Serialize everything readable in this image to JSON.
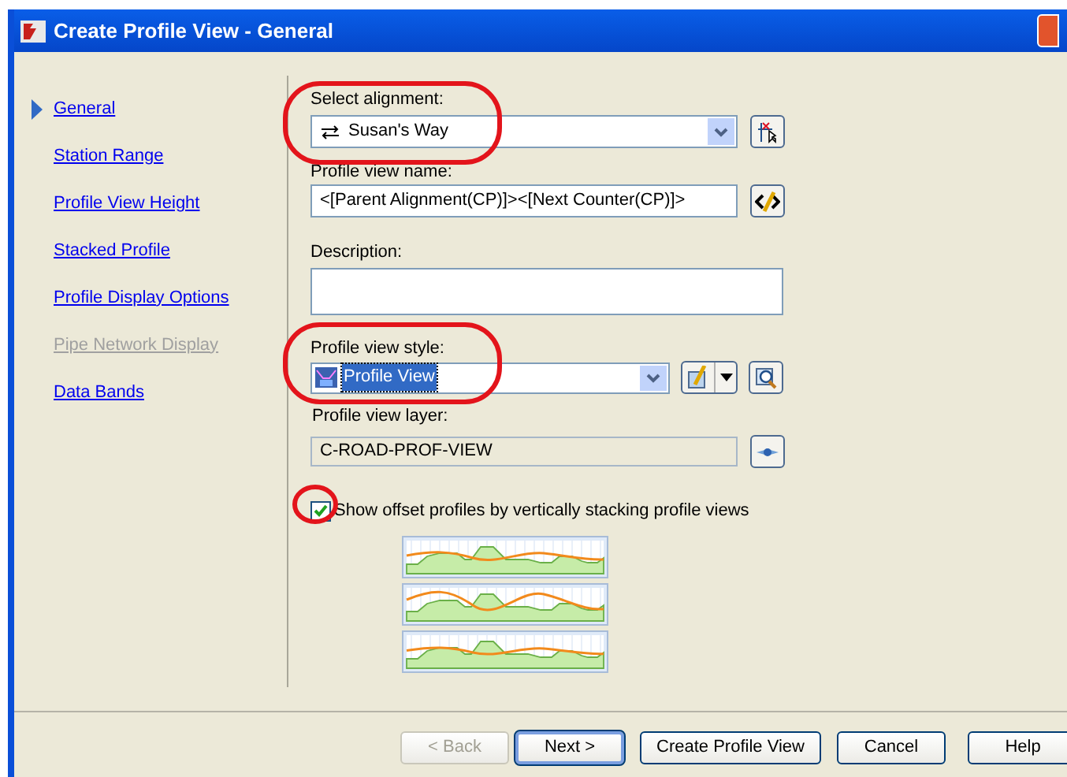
{
  "window": {
    "title": "Create Profile View - General"
  },
  "sidebar": {
    "items": [
      {
        "label": "General",
        "selected": true,
        "disabled": false
      },
      {
        "label": "Station Range",
        "selected": false,
        "disabled": false
      },
      {
        "label": "Profile View Height",
        "selected": false,
        "disabled": false
      },
      {
        "label": "Stacked Profile",
        "selected": false,
        "disabled": false
      },
      {
        "label": "Profile Display Options",
        "selected": false,
        "disabled": false
      },
      {
        "label": "Pipe Network Display",
        "selected": false,
        "disabled": true
      },
      {
        "label": "Data Bands",
        "selected": false,
        "disabled": false
      }
    ]
  },
  "form": {
    "alignment": {
      "label": "Select alignment:",
      "value": "Susan's Way"
    },
    "name": {
      "label": "Profile view name:",
      "value": "<[Parent Alignment(CP)]><[Next Counter(CP)]>"
    },
    "description": {
      "label": "Description:"
    },
    "style": {
      "label": "Profile view style:",
      "value": "Profile View",
      "text_selected": true
    },
    "layer": {
      "label": "Profile view layer:",
      "value": "C-ROAD-PROF-VIEW"
    },
    "stack_option": {
      "label": "Show offset profiles by vertically stacking profile views",
      "checked": true
    }
  },
  "buttons": [
    {
      "label": "< Back",
      "disabled": true,
      "default": false
    },
    {
      "label": "Next >",
      "disabled": false,
      "default": true
    },
    {
      "label": "Create Profile View",
      "disabled": false,
      "default": false
    },
    {
      "label": "Cancel",
      "disabled": false,
      "default": false
    },
    {
      "label": "Help",
      "disabled": false,
      "default": false
    }
  ]
}
